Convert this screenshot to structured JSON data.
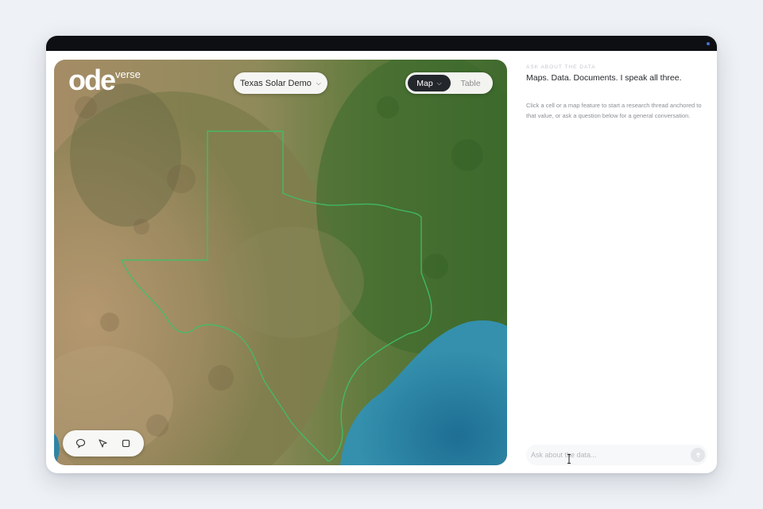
{
  "app": {
    "logo_text": "ode",
    "logo_suffix": "verse"
  },
  "toolbar": {
    "dataset_label": "Texas Solar Demo",
    "dataset_icon": "chevron-down-icon",
    "view_modes": [
      {
        "label": "Map",
        "active": true
      },
      {
        "label": "Table",
        "active": false
      }
    ]
  },
  "map_tools": [
    {
      "name": "comment-tool",
      "icon": "speech-bubble-icon"
    },
    {
      "name": "select-tool",
      "icon": "pointer-arrow-icon"
    },
    {
      "name": "box-select-tool",
      "icon": "square-icon"
    }
  ],
  "assistant": {
    "eyebrow": "ASK ABOUT THE DATA",
    "headline": "Maps. Data. Documents. I speak all three.",
    "intro": "Click a cell or a map feature to start a research thread anchored to that value, or ask a question below for a general conversation.",
    "input_placeholder": "Ask about the data...",
    "send_icon": "send-arrow-icon"
  },
  "colors": {
    "active_toggle": "#23272c",
    "boundary": "#3fbf6a",
    "water": "#2c7fa0"
  }
}
